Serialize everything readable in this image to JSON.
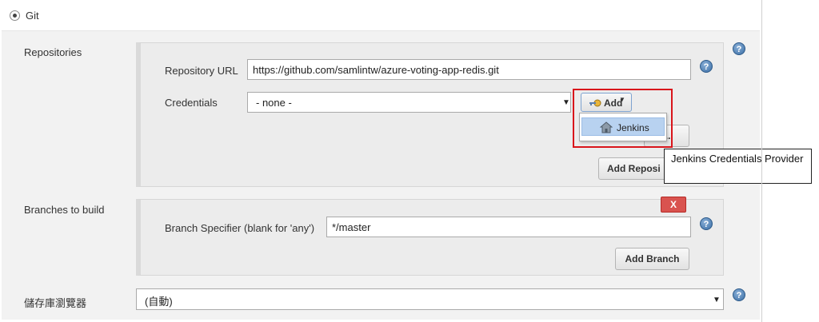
{
  "scm": {
    "git_option_label": "Git"
  },
  "repositories": {
    "section_label": "Repositories",
    "repo_url_label": "Repository URL",
    "repo_url_value": "https://github.com/samlintw/azure-voting-app-redis.git",
    "credentials_label": "Credentials",
    "credentials_selected": "- none -",
    "add_button_label": "Add",
    "add_menu_items": [
      "Jenkins"
    ],
    "advanced_button_label": "...",
    "add_repository_button_label": "Add Reposi",
    "tooltip_text": "Jenkins Credentials Provider"
  },
  "branches": {
    "section_label": "Branches to build",
    "delete_button_label": "X",
    "specifier_label": "Branch Specifier (blank for 'any')",
    "specifier_value": "*/master",
    "add_branch_button_label": "Add Branch"
  },
  "repo_browser": {
    "label": "儲存庫瀏覽器",
    "selected": "(自動)"
  },
  "help_glyph": "?",
  "caret_glyph": "▼",
  "icons": {
    "help": "help-icon",
    "add_key": "key-icon",
    "jenkins_home": "jenkins-home-icon"
  },
  "colors": {
    "highlight": "#d9151b",
    "delete_button": "#d9534f",
    "menu_highlight": "#b8d2f0",
    "help_icon": "#3b6ea5"
  }
}
